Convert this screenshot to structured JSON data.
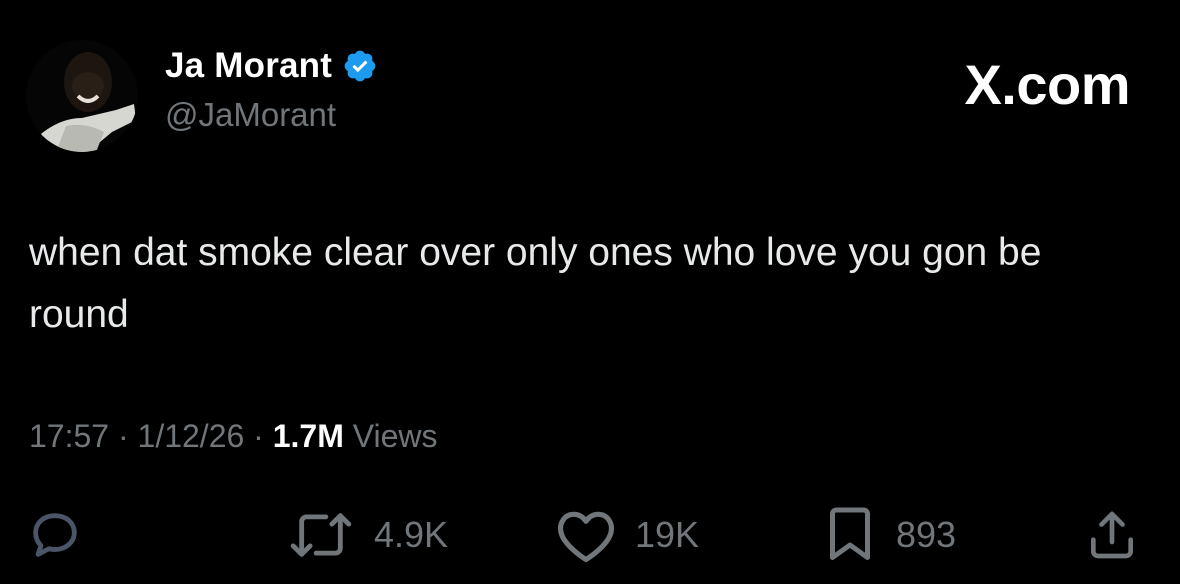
{
  "author": {
    "display_name": "Ja Morant",
    "handle": "@JaMorant",
    "verified": true,
    "avatar": "avatar-photo"
  },
  "brand": {
    "label": "X.com"
  },
  "tweet": {
    "text": "when dat smoke clear over only ones who love you gon be round"
  },
  "meta": {
    "time": "17:57",
    "separator": " · ",
    "date": "1/12/26",
    "views_count": "1.7M",
    "views_label": " Views"
  },
  "actions": {
    "reply": {
      "icon": "reply-icon",
      "count": ""
    },
    "retweet": {
      "icon": "retweet-icon",
      "count": "4.9K"
    },
    "like": {
      "icon": "heart-icon",
      "count": "19K"
    },
    "bookmark": {
      "icon": "bookmark-icon",
      "count": "893"
    },
    "share": {
      "icon": "share-icon"
    }
  },
  "colors": {
    "background": "#000000",
    "primary_text": "#e7e9ea",
    "secondary_text": "#71767b",
    "verified_blue": "#1d9bf0",
    "reply_icon": "#4a5568"
  }
}
